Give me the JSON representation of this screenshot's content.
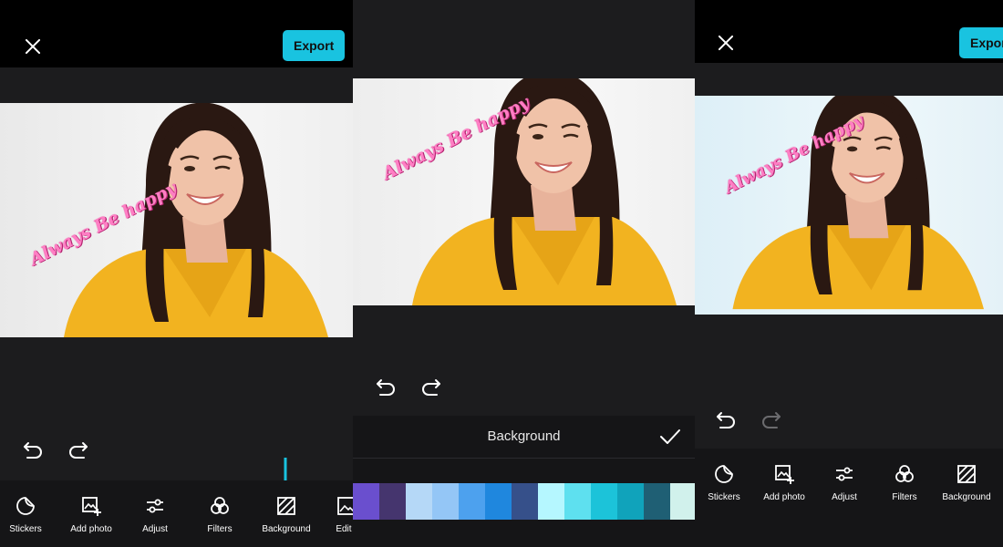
{
  "left_screen": {
    "export_label": "Export",
    "caption": "Always Be happy",
    "tools": [
      {
        "label": "Stickers",
        "icon": "sticker-icon"
      },
      {
        "label": "Add photo",
        "icon": "add-photo-icon"
      },
      {
        "label": "Adjust",
        "icon": "sliders-icon"
      },
      {
        "label": "Filters",
        "icon": "filters-icon"
      },
      {
        "label": "Background",
        "icon": "background-icon"
      },
      {
        "label": "Edit r",
        "icon": "edit-image-icon"
      }
    ]
  },
  "middle_screen": {
    "caption": "Always Be happy",
    "sheet_title": "Background",
    "swatches": [
      "#6a4fce",
      "#45356e",
      "#b5d8f7",
      "#94c6f6",
      "#4da1ee",
      "#1f87de",
      "#36508a",
      "#b5f7ff",
      "#5ee0ef",
      "#1cc3d9",
      "#10a3bb",
      "#1f5f74",
      "#d1f1ec",
      "#98d7c9",
      "#19b99b"
    ]
  },
  "right_screen": {
    "export_label": "Export",
    "caption": "Always Be happy",
    "tools": [
      {
        "label": "Stickers",
        "icon": "sticker-icon"
      },
      {
        "label": "Add photo",
        "icon": "add-photo-icon"
      },
      {
        "label": "Adjust",
        "icon": "sliders-icon"
      },
      {
        "label": "Filters",
        "icon": "filters-icon"
      },
      {
        "label": "Background",
        "icon": "background-icon"
      }
    ]
  },
  "colors": {
    "accent": "#19c3e0",
    "caption_pink": "#ff7ec4",
    "shirt_yellow": "#f2b320",
    "hair_brown": "#2a1812"
  }
}
